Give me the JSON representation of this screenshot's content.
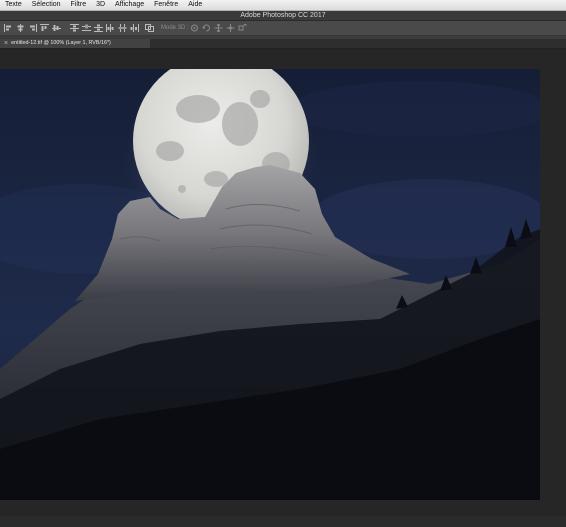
{
  "menubar": {
    "items": [
      {
        "label": "Texte"
      },
      {
        "label": "Sélection"
      },
      {
        "label": "Filtre"
      },
      {
        "label": "3D"
      },
      {
        "label": "Affichage"
      },
      {
        "label": "Fenêtre"
      },
      {
        "label": "Aide"
      }
    ]
  },
  "app": {
    "title": "Adobe Photoshop CC 2017"
  },
  "options": {
    "mode3d_label": "Mode 3D :"
  },
  "document": {
    "tab_title": "entitled-12.tif @ 100% (Layer 1, RVB/16*)"
  },
  "colors": {
    "sky_top": "#17213a",
    "sky_bottom": "#1f2b4a",
    "moon": "#dcdcd6",
    "rock": "#8e8e8e",
    "foreground": "#0c0e14"
  }
}
